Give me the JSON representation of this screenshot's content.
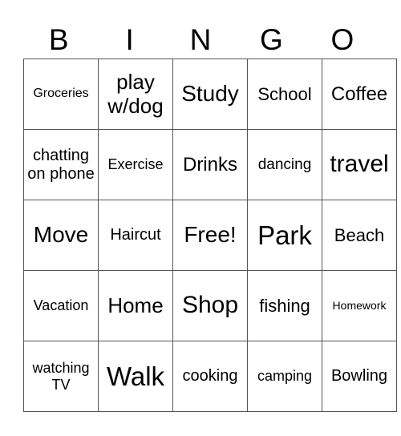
{
  "header": [
    "B",
    "I",
    "N",
    "G",
    "O"
  ],
  "rows": [
    [
      "Groceries",
      "play w/dog",
      "Study",
      "School",
      "Coffee"
    ],
    [
      "chatting on phone",
      "Exercise",
      "Drinks",
      "dancing",
      "travel"
    ],
    [
      "Move",
      "Haircut",
      "Free!",
      "Park",
      "Beach"
    ],
    [
      "Vacation",
      "Home",
      "Shop",
      "fishing",
      "Homework"
    ],
    [
      "watching TV",
      "Walk",
      "cooking",
      "camping",
      "Bowling"
    ]
  ]
}
